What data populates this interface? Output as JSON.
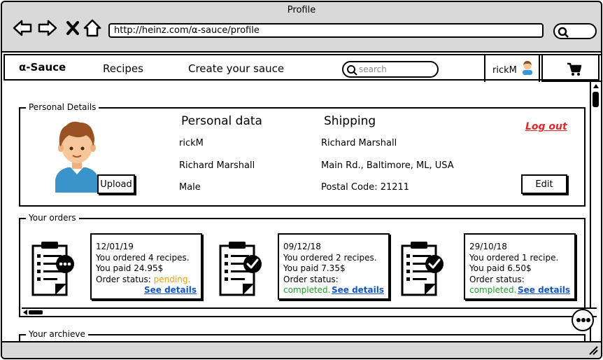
{
  "window": {
    "title": "Profile"
  },
  "browser": {
    "url": "http://heinz.com/α-sauce/profile",
    "icons": [
      "back-arrow-icon",
      "forward-arrow-icon",
      "close-x-icon",
      "home-icon",
      "search-icon"
    ]
  },
  "appbar": {
    "brand": "α-Sauce",
    "nav": [
      "Recipes",
      "Create your sauce"
    ],
    "search_placeholder": "search",
    "username": "rickM",
    "cart_icon": "cart-icon"
  },
  "personal": {
    "legend": "Personal Details",
    "upload_label": "Upload",
    "personal_heading": "Personal data",
    "shipping_heading": "Shipping",
    "personal_fields": [
      "rickM",
      "Richard Marshall",
      "Male"
    ],
    "shipping_fields": [
      "Richard Marshall",
      "Main Rd., Baltimore, ML, USA",
      "Postal Code: 21211"
    ],
    "logout_label": "Log out",
    "edit_label": "Edit"
  },
  "orders": {
    "legend": "Your orders",
    "items": [
      {
        "date": "12/01/19",
        "ordered": "You ordered 4 recipes.",
        "paid": "You paid 24.95$",
        "status_label": "Order status:",
        "status": "pending.",
        "status_color": "#f59e0b",
        "link": "See details",
        "icon": "clipboard-pending-icon"
      },
      {
        "date": "09/12/18",
        "ordered": "You ordered 2 recipes.",
        "paid": "You paid 7.35$",
        "status_label": "Order status:",
        "status": "completed.",
        "status_color": "#1e9e2a",
        "link": "See details",
        "icon": "clipboard-check-icon"
      },
      {
        "date": "29/10/18",
        "ordered": "You ordered 1 recipe.",
        "paid": "You paid 6.50$",
        "status_label": "Order status:",
        "status": "completed.",
        "status_color": "#1e9e2a",
        "link": "See details",
        "icon": "clipboard-check-icon"
      }
    ]
  },
  "archive": {
    "legend": "Your archieve"
  },
  "colors": {
    "logout": "#e8262a",
    "link": "#1556c7",
    "pending": "#f59e0b",
    "completed": "#1e9e2a",
    "chrome": "#d9d9d9"
  }
}
